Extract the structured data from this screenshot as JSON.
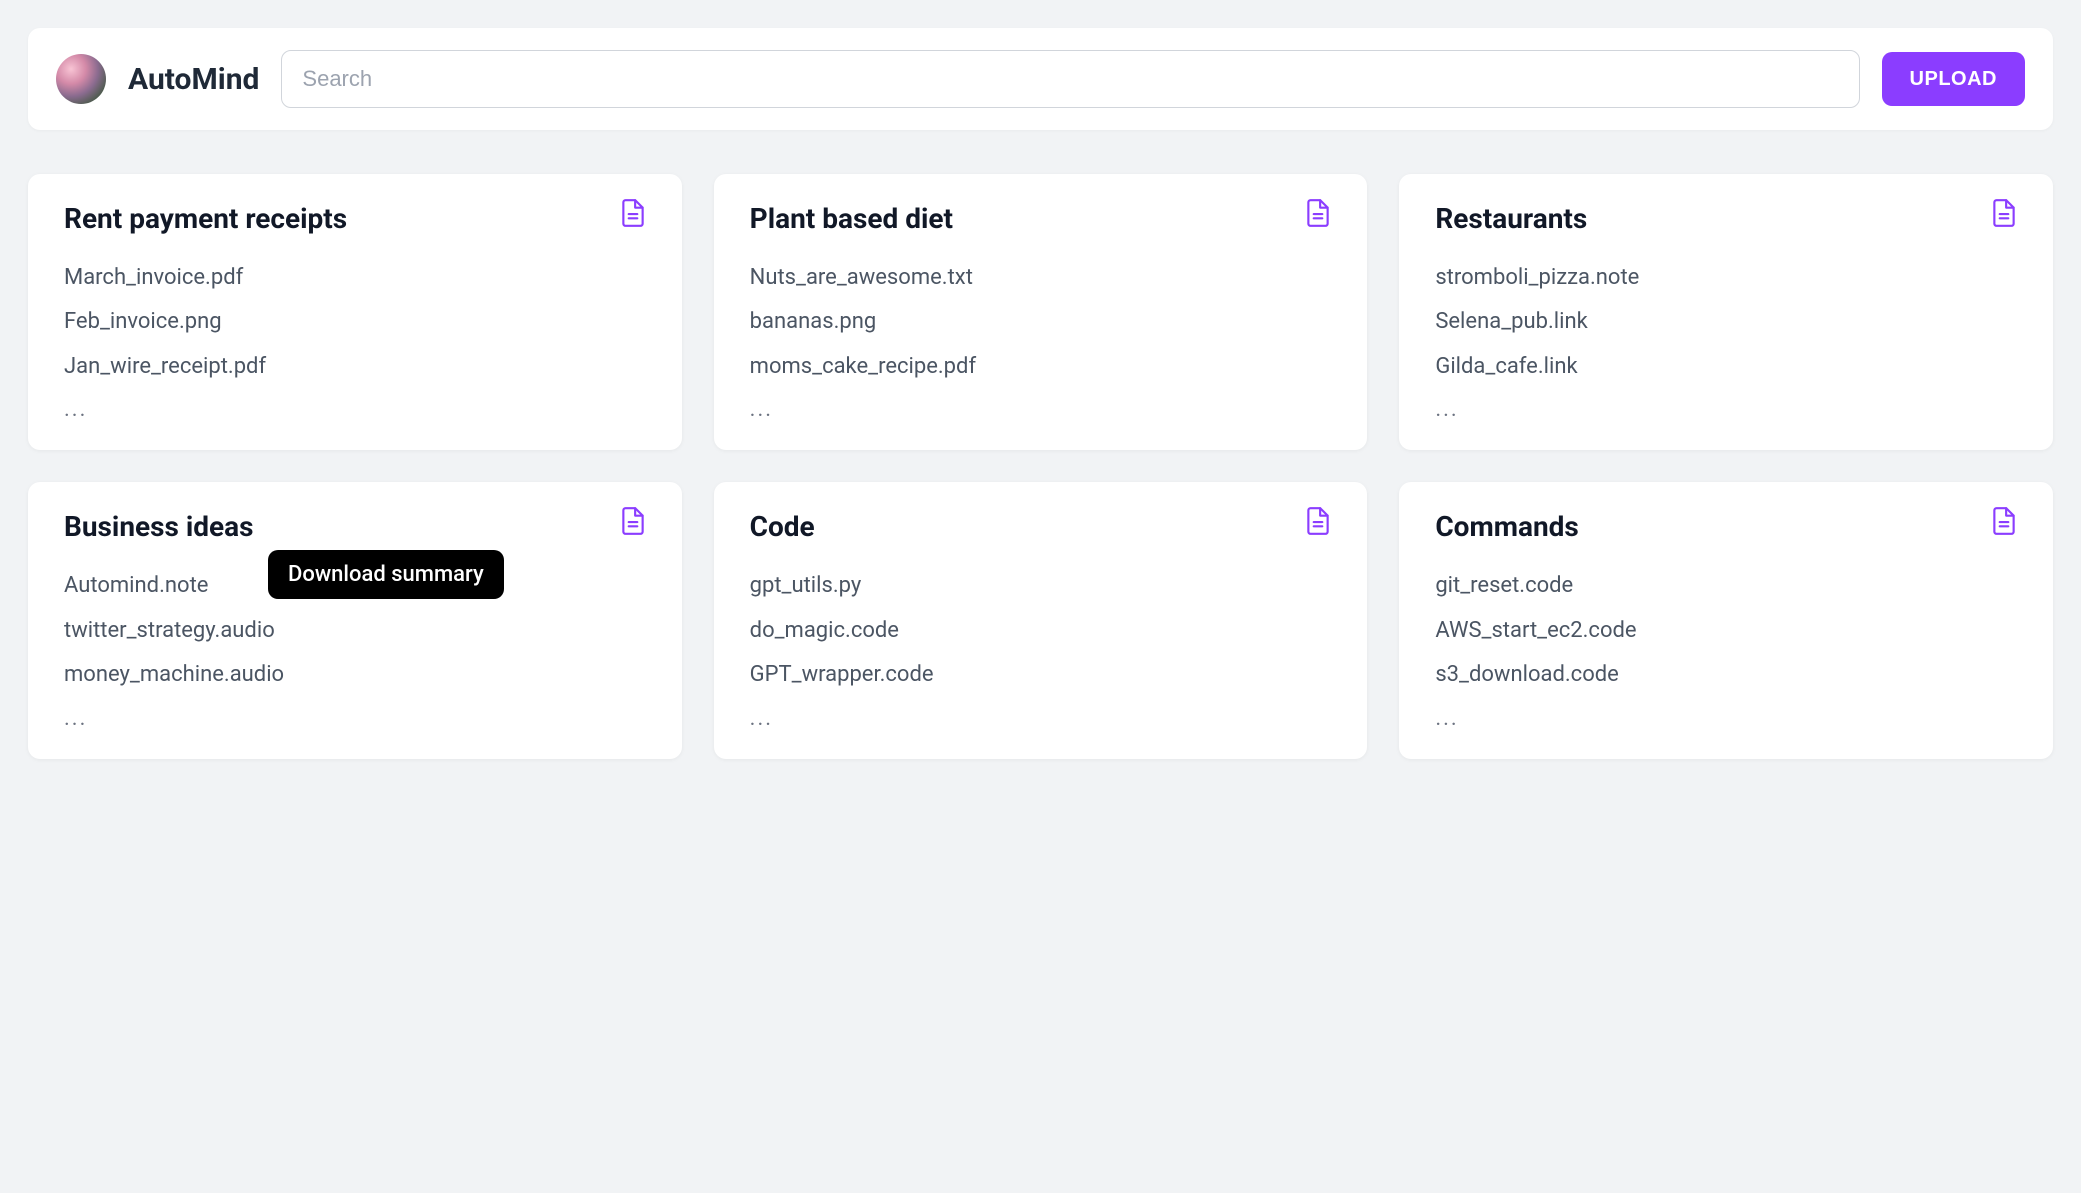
{
  "header": {
    "brand": "AutoMind",
    "search_placeholder": "Search",
    "upload_label": "UPLOAD"
  },
  "tooltip": {
    "text": "Download summary",
    "card_index": 3
  },
  "cards": [
    {
      "title": "Rent payment receipts",
      "files": [
        "March_invoice.pdf",
        "Feb_invoice.png",
        "Jan_wire_receipt.pdf"
      ],
      "more": "..."
    },
    {
      "title": "Plant based diet",
      "files": [
        "Nuts_are_awesome.txt",
        "bananas.png",
        "moms_cake_recipe.pdf"
      ],
      "more": "..."
    },
    {
      "title": "Restaurants",
      "files": [
        "stromboli_pizza.note",
        "Selena_pub.link",
        "Gilda_cafe.link"
      ],
      "more": "..."
    },
    {
      "title": "Business ideas",
      "files": [
        "Automind.note",
        "twitter_strategy.audio",
        "money_machine.audio"
      ],
      "more": "..."
    },
    {
      "title": "Code",
      "files": [
        "gpt_utils.py",
        "do_magic.code",
        "GPT_wrapper.code"
      ],
      "more": "..."
    },
    {
      "title": "Commands",
      "files": [
        "git_reset.code",
        "AWS_start_ec2.code",
        "s3_download.code"
      ],
      "more": "..."
    }
  ]
}
